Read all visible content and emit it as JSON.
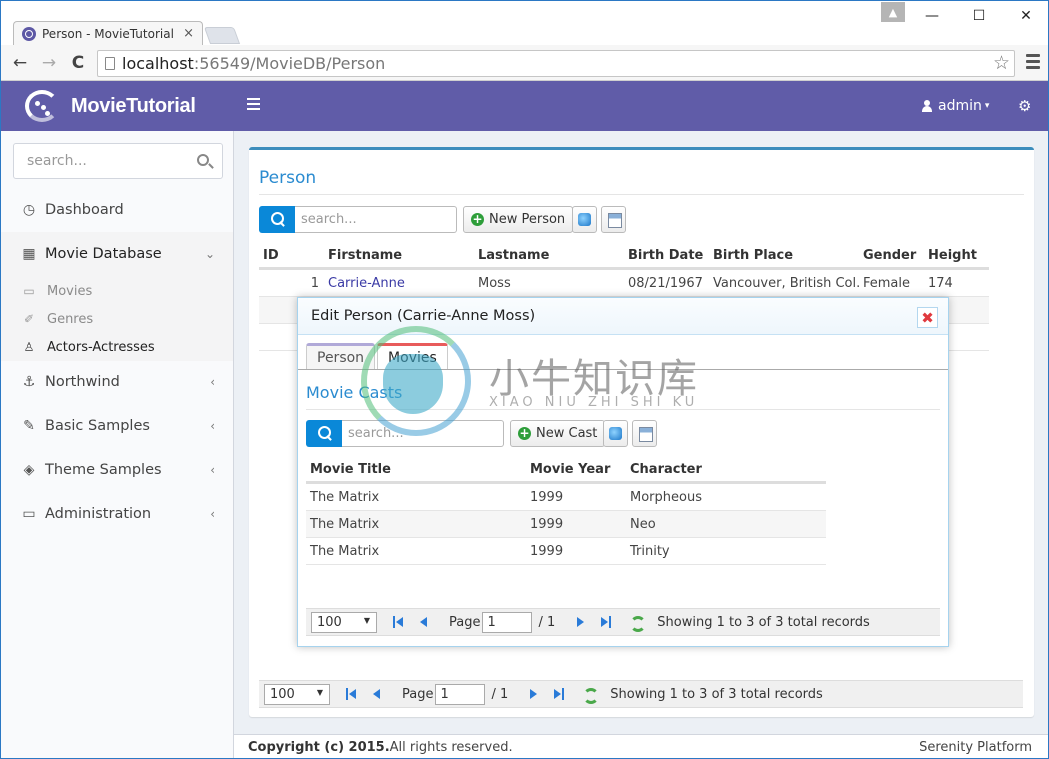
{
  "browser": {
    "tab_title": "Person - MovieTutorial",
    "tab_close": "×",
    "url_host": "localhost",
    "url_rest": ":56549/MovieDB/Person",
    "back": "←",
    "forward": "→",
    "reload": "C",
    "star": "☆",
    "minimize": "—",
    "maximize": "☐",
    "close": "✕",
    "profile": "👤"
  },
  "header": {
    "app_name": "MovieTutorial",
    "user": "admin",
    "user_caret": "▾",
    "settings_icon": "⚙"
  },
  "sidebar": {
    "search_placeholder": "search...",
    "items": [
      {
        "label": "Dashboard",
        "icon": "◷"
      },
      {
        "label": "Movie Database",
        "icon": "▦",
        "chevron": "⌄"
      },
      {
        "label": "Northwind",
        "icon": "⚓",
        "chevron": "‹"
      },
      {
        "label": "Basic Samples",
        "icon": "✎",
        "chevron": "‹"
      },
      {
        "label": "Theme Samples",
        "icon": "◈",
        "chevron": "‹"
      },
      {
        "label": "Administration",
        "icon": "▭",
        "chevron": "‹"
      }
    ],
    "sub_items": [
      {
        "label": "Movies",
        "icon": "▭"
      },
      {
        "label": "Genres",
        "icon": "✐"
      },
      {
        "label": "Actors-Actresses",
        "icon": "♙"
      }
    ]
  },
  "main": {
    "title": "Person",
    "search_placeholder": "search...",
    "new_button": "New Person",
    "columns": [
      "ID",
      "Firstname",
      "Lastname",
      "Birth Date",
      "Birth Place",
      "Gender",
      "Height"
    ],
    "rows": [
      {
        "id": "1",
        "firstname": "Carrie-Anne",
        "lastname": "Moss",
        "birth_date": "08/21/1967",
        "birth_place": "Vancouver, British Col...",
        "gender": "Female",
        "height": "174"
      }
    ],
    "pager": {
      "page_size": "100",
      "page_label": "Page",
      "page": "1",
      "total_pages": "/ 1",
      "info": "Showing 1 to 3 of 3 total records"
    }
  },
  "dialog": {
    "title": "Edit Person (Carrie-Anne Moss)",
    "close": "✖",
    "tabs": [
      "Person",
      "Movies"
    ],
    "active_tab": "Movies",
    "section_title": "Movie Casts",
    "search_placeholder": "search...",
    "new_button": "New Cast",
    "columns": [
      "Movie Title",
      "Movie Year",
      "Character"
    ],
    "rows": [
      {
        "title": "The Matrix",
        "year": "1999",
        "character": "Morpheous"
      },
      {
        "title": "The Matrix",
        "year": "1999",
        "character": "Neo"
      },
      {
        "title": "The Matrix",
        "year": "1999",
        "character": "Trinity"
      }
    ],
    "pager": {
      "page_size": "100",
      "page_label": "Page",
      "page": "1",
      "total_pages": "/ 1",
      "info": "Showing 1 to 3 of 3 total records"
    }
  },
  "watermark": {
    "cn": "小牛知识库",
    "en": "XIAO NIU ZHI SHI KU"
  },
  "footer": {
    "copyright_bold": "Copyright (c) 2015.",
    "copyright_rest": " All rights reserved.",
    "platform": "Serenity Platform"
  },
  "colors": {
    "header_bg": "#605ca8",
    "accent_blue": "#3c8dbc",
    "title_blue": "#2a8bd0",
    "search_btn": "#0a88d8"
  }
}
